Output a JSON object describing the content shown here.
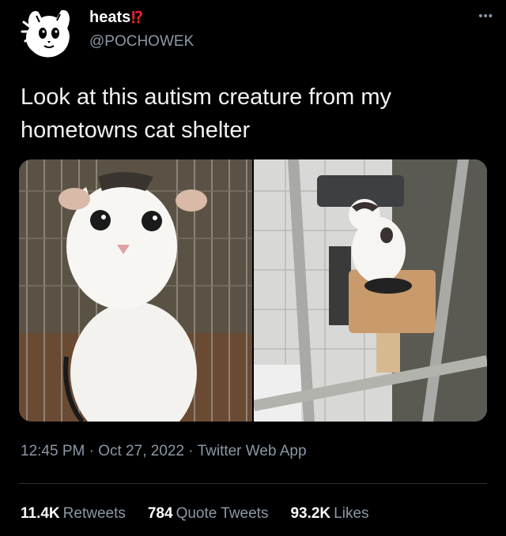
{
  "author": {
    "display_name": "heats",
    "name_emoji": "⁉",
    "handle": "@POCHOWEK",
    "avatar_icon": "cartoon-cat-avatar-icon"
  },
  "menu_icon": "more-options-icon",
  "tweet": {
    "text": "Look at this autism creature from my hometowns cat shelter",
    "time": "12:45 PM",
    "date": "Oct 27, 2022",
    "source": "Twitter Web App",
    "separator": "·"
  },
  "media": [
    {
      "description_icon": "white-cat-photo"
    },
    {
      "description_icon": "white-cat-on-scratching-post-photo"
    }
  ],
  "stats": [
    {
      "count": "11.4K",
      "label": "Retweets"
    },
    {
      "count": "784",
      "label": "Quote Tweets"
    },
    {
      "count": "93.2K",
      "label": "Likes"
    }
  ],
  "colors": {
    "background": "#000000",
    "primary_text": "#e7e9ea",
    "secondary_text": "#8b98a5",
    "divider": "#2f3336",
    "emoji_red": "#f4212e"
  }
}
